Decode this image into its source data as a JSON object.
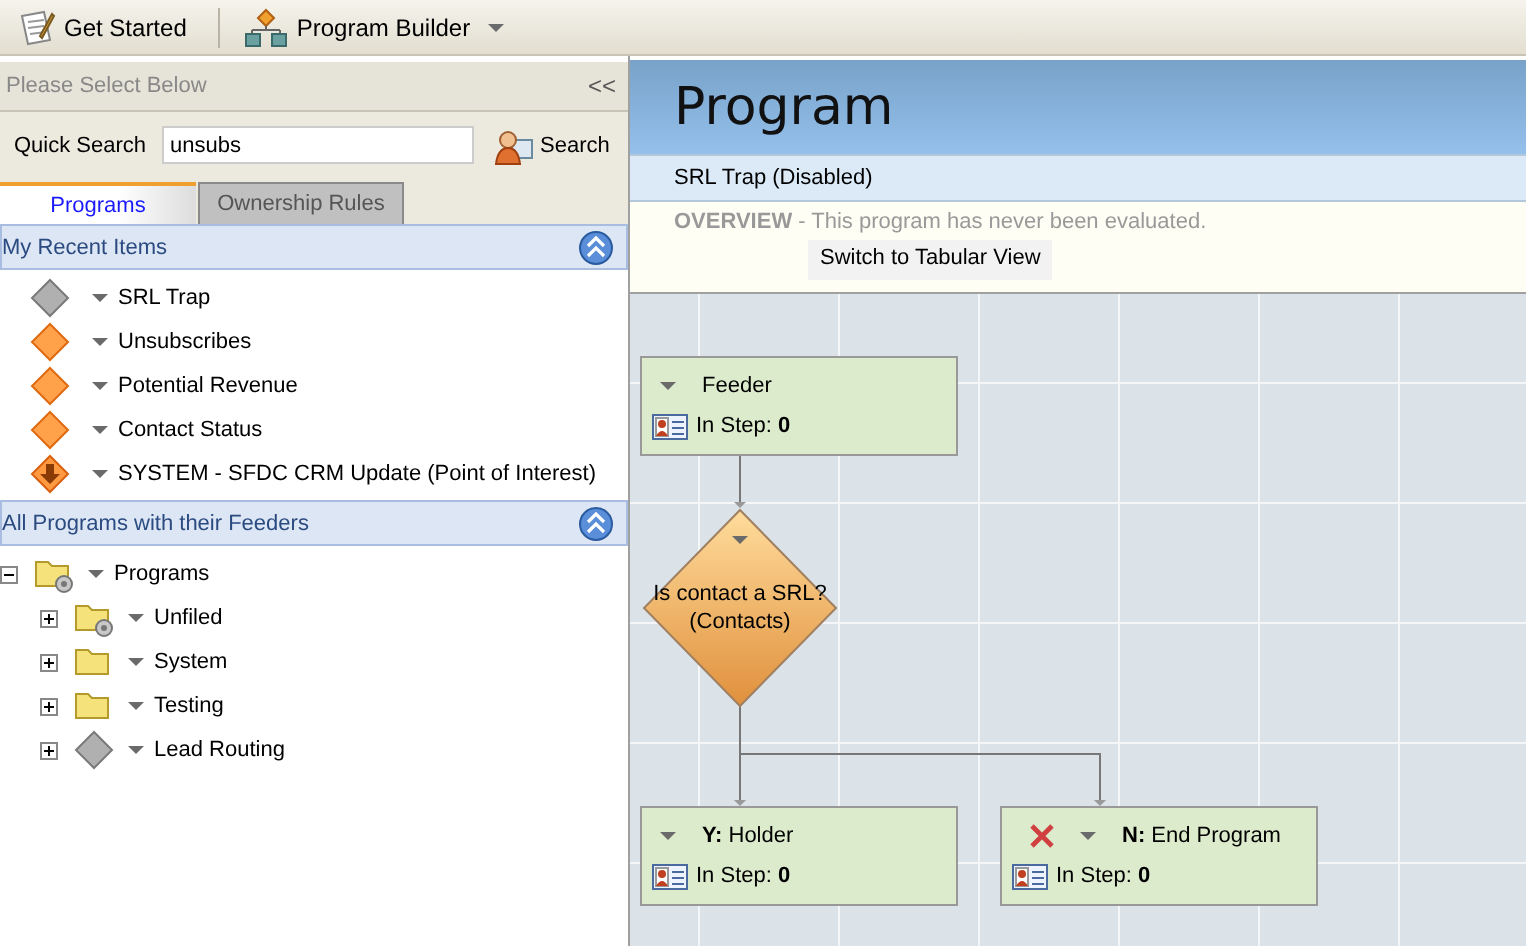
{
  "toolbar": [
    {
      "kind": "get-started",
      "label": "Get Started",
      "dropdown": false
    },
    {
      "kind": "program-builder",
      "label": "Program Builder",
      "dropdown": true
    }
  ],
  "sidebar": {
    "header": "Please Select Below",
    "collapse": "<<",
    "search": {
      "label": "Quick Search",
      "value": "unsubs",
      "button": "Search"
    },
    "tabs": [
      {
        "label": "Programs",
        "selected": true
      },
      {
        "label": "Ownership Rules",
        "selected": false
      }
    ],
    "sections": [
      {
        "title": "My Recent Items",
        "kind": "list",
        "items": [
          {
            "label": "SRL Trap",
            "kind": "disabled"
          },
          {
            "label": "Unsubscribes",
            "kind": "active"
          },
          {
            "label": "Potential Revenue",
            "kind": "active"
          },
          {
            "label": "Contact Status",
            "kind": "active"
          },
          {
            "label": "SYSTEM - SFDC CRM Update (Point of Interest)",
            "kind": "interest"
          }
        ]
      },
      {
        "title": "All Programs with their Feeders",
        "kind": "tree",
        "items": [
          {
            "label": "Programs",
            "kind": "gear-folder",
            "expanded": true,
            "children": [
              {
                "label": "Unfiled",
                "kind": "gear-folder",
                "expanded": false
              },
              {
                "label": "System",
                "kind": "folder",
                "expanded": false
              },
              {
                "label": "Testing",
                "kind": "folder",
                "expanded": false
              },
              {
                "label": "Lead Routing",
                "kind": "disabled",
                "expanded": false
              }
            ]
          }
        ]
      }
    ]
  },
  "main": {
    "title": "Program",
    "program_name": "SRL Trap (Disabled)",
    "overview": {
      "label": "OVERVIEW",
      "text": "- This program has never been evaluated."
    },
    "switch_button": "Switch to Tabular View",
    "nodes": [
      {
        "kind": "step",
        "label": "Feeder",
        "count": "In Step: **0**",
        "error": false
      },
      {
        "kind": "decision",
        "lines": [
          "Is contact a SRL?",
          "(Contacts)"
        ]
      },
      {
        "kind": "step",
        "label": "**Y:** Holder",
        "count": "In Step: **0**",
        "error": false
      },
      {
        "kind": "step",
        "label": "**N:** End Program",
        "count": "In Step: **0**",
        "error": true
      }
    ]
  }
}
